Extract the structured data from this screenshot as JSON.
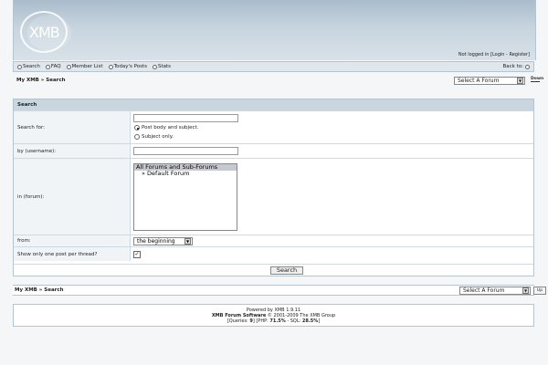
{
  "header": {
    "logo_text": "XMB",
    "login_prefix": "Not logged in [",
    "login_link": "Login",
    "login_sep": " - ",
    "register_link": "Register",
    "login_suffix": "]"
  },
  "nav": {
    "items": [
      {
        "label": "Search"
      },
      {
        "label": "FAQ"
      },
      {
        "label": "Member List"
      },
      {
        "label": "Today's Posts"
      },
      {
        "label": "Stats"
      }
    ],
    "back_to": "Back to:"
  },
  "breadcrumb": {
    "text": "My XMB » Search",
    "select_value": "Select A Forum",
    "down_label": "Down"
  },
  "form": {
    "title": "Search",
    "search_for_label": "Search for:",
    "search_for_value": "",
    "radio_1": "Post body and subject.",
    "radio_2": "Subject only.",
    "username_label": "by (username):",
    "username_value": "",
    "forum_label": "in (forum):",
    "forum_options": [
      "All Forums and Sub-Forums",
      "» Default Forum"
    ],
    "from_label": "from:",
    "from_value": "the beginning",
    "one_post_label": "Show only one post per thread?",
    "search_button": "Search"
  },
  "breadcrumb_bottom": {
    "text": "My XMB » Search",
    "select_value": "Select A Forum",
    "up_label": "Up"
  },
  "footer": {
    "line1": "Powered by XMB 1.9.11",
    "line2_bold": "XMB Forum Software",
    "line2_rest": " © 2001-2009 The XMB Group",
    "queries_label": "[Queries: ",
    "queries_value": "9",
    "php_label": "] [PHP: ",
    "php_value": "71.5%",
    "sql_label": " - SQL: ",
    "sql_value": "28.5%",
    "end": "]"
  }
}
